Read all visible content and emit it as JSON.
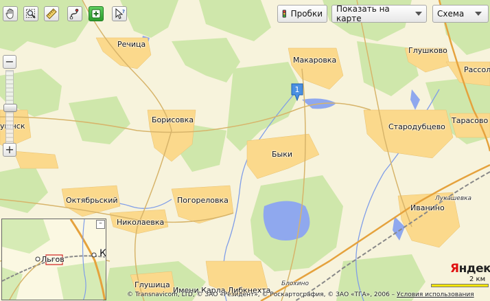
{
  "toolbar": {
    "tools": [
      {
        "icon": "hand-pan-icon",
        "active": false
      },
      {
        "icon": "magnifier-zoom-icon",
        "active": false
      },
      {
        "icon": "ruler-icon",
        "active": false
      },
      {
        "icon": "route-icon",
        "active": false
      },
      {
        "icon": "add-placemark-icon",
        "active": true
      },
      {
        "icon": "info-cursor-icon",
        "active": false
      }
    ],
    "traffic_label": "Пробки",
    "show_on_map_label": "Показать на карте",
    "map_type_label": "Схема"
  },
  "zoom": {
    "plus": "+",
    "minus": "−",
    "level_fraction": 0.5
  },
  "marker": {
    "number": "1"
  },
  "places": {
    "rechitsa": "Речица",
    "makarovka": "Макаровка",
    "glushkovo": "Глушково",
    "rassol": "Рассол",
    "borisovka": "Борисовка",
    "starodubtsevo": "Стародубцево",
    "tarasovo": "Тарасово",
    "kushnsk": "ушнск",
    "byki": "Быки",
    "oktyabrsky": "Октябрьский",
    "pogorelovka": "Погореловка",
    "nikolaevka": "Николаевка",
    "ivanino": "Иванино",
    "lukashevka": "Лукашевка",
    "glushitsa": "Глушица",
    "karla_libknekhta": "Имени Карла Либкнехта",
    "blokhino": "Блохино"
  },
  "minimap": {
    "city": "Льгов",
    "partial_label": "К",
    "collapse": "–"
  },
  "copyright": {
    "text": "© Transnavicom, LTD, © ЗАО «Резидент», © Роскартография, © ЗАО «ТГА», 2006 – ",
    "terms_link": "Условия использования"
  },
  "logo": {
    "first": "Я",
    "rest": "ндекс"
  },
  "scale": {
    "label": "2 км",
    "color": "#f4e400"
  },
  "colors": {
    "background": "#f7f3dc",
    "forest": "#cfe7ab",
    "settlement": "#fbd98c",
    "water": "#8fa8ee",
    "road": "#d7b46a",
    "highway": "#e5a23d"
  }
}
